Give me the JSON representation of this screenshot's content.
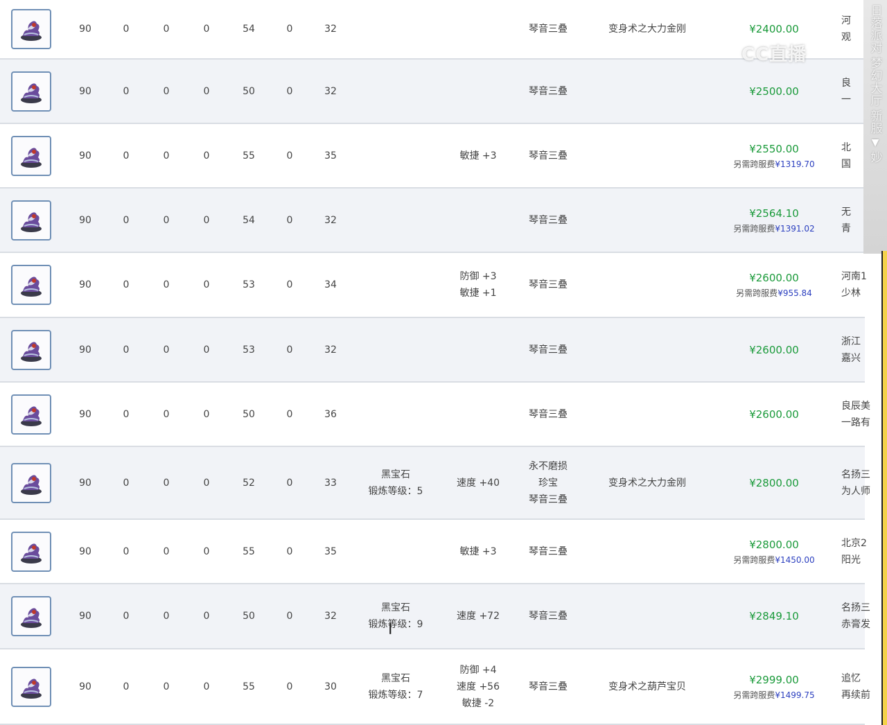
{
  "colors": {
    "price": "#1a9a3a",
    "fee": "#2b3fbf",
    "row_alt": "#f1f3f7",
    "accent_bar": "#f4d24a"
  },
  "listings": [
    {
      "level": "90",
      "c1": "0",
      "c2": "0",
      "c3": "0",
      "c4": "54",
      "c5": "0",
      "c6": "32",
      "gem": [],
      "attrs": [],
      "special": [
        "琴音三叠"
      ],
      "transform": "变身术之大力金刚",
      "price": "¥2400.00",
      "fee": null,
      "seller": [
        "河",
        "观"
      ]
    },
    {
      "level": "90",
      "c1": "0",
      "c2": "0",
      "c3": "0",
      "c4": "50",
      "c5": "0",
      "c6": "32",
      "gem": [],
      "attrs": [],
      "special": [
        "琴音三叠"
      ],
      "transform": "",
      "price": "¥2500.00",
      "fee": null,
      "seller": [
        "良",
        "一"
      ]
    },
    {
      "level": "90",
      "c1": "0",
      "c2": "0",
      "c3": "0",
      "c4": "55",
      "c5": "0",
      "c6": "35",
      "gem": [],
      "attrs": [
        "敏捷 +3"
      ],
      "special": [
        "琴音三叠"
      ],
      "transform": "",
      "price": "¥2550.00",
      "fee": "¥1319.70",
      "seller": [
        "北",
        "国"
      ]
    },
    {
      "level": "90",
      "c1": "0",
      "c2": "0",
      "c3": "0",
      "c4": "54",
      "c5": "0",
      "c6": "32",
      "gem": [],
      "attrs": [],
      "special": [
        "琴音三叠"
      ],
      "transform": "",
      "price": "¥2564.10",
      "fee": "¥1391.02",
      "seller": [
        "无",
        "青"
      ]
    },
    {
      "level": "90",
      "c1": "0",
      "c2": "0",
      "c3": "0",
      "c4": "53",
      "c5": "0",
      "c6": "34",
      "gem": [],
      "attrs": [
        "防御 +3",
        "敏捷 +1"
      ],
      "special": [
        "琴音三叠"
      ],
      "transform": "",
      "price": "¥2600.00",
      "fee": "¥955.84",
      "seller": [
        "河南1",
        "少林"
      ]
    },
    {
      "level": "90",
      "c1": "0",
      "c2": "0",
      "c3": "0",
      "c4": "53",
      "c5": "0",
      "c6": "32",
      "gem": [],
      "attrs": [],
      "special": [
        "琴音三叠"
      ],
      "transform": "",
      "price": "¥2600.00",
      "fee": null,
      "seller": [
        "浙江",
        "嘉兴"
      ]
    },
    {
      "level": "90",
      "c1": "0",
      "c2": "0",
      "c3": "0",
      "c4": "50",
      "c5": "0",
      "c6": "36",
      "gem": [],
      "attrs": [],
      "special": [
        "琴音三叠"
      ],
      "transform": "",
      "price": "¥2600.00",
      "fee": null,
      "seller": [
        "良辰美",
        "一路有"
      ]
    },
    {
      "level": "90",
      "c1": "0",
      "c2": "0",
      "c3": "0",
      "c4": "52",
      "c5": "0",
      "c6": "33",
      "gem": [
        "黑宝石",
        "锻炼等级：5"
      ],
      "attrs": [
        "速度 +40"
      ],
      "special": [
        "永不磨损",
        "珍宝",
        "琴音三叠"
      ],
      "transform": "变身术之大力金刚",
      "price": "¥2800.00",
      "fee": null,
      "seller": [
        "名扬三",
        "为人师"
      ]
    },
    {
      "level": "90",
      "c1": "0",
      "c2": "0",
      "c3": "0",
      "c4": "55",
      "c5": "0",
      "c6": "35",
      "gem": [],
      "attrs": [
        "敏捷 +3"
      ],
      "special": [
        "琴音三叠"
      ],
      "transform": "",
      "price": "¥2800.00",
      "fee": "¥1450.00",
      "seller": [
        "北京2",
        "阳光"
      ]
    },
    {
      "level": "90",
      "c1": "0",
      "c2": "0",
      "c3": "0",
      "c4": "50",
      "c5": "0",
      "c6": "32",
      "gem": [
        "黑宝石",
        "锻炼等级：9"
      ],
      "attrs": [
        "速度 +72"
      ],
      "special": [
        "琴音三叠"
      ],
      "transform": "",
      "price": "¥2849.10",
      "fee": null,
      "seller": [
        "名扬三",
        "赤膏发"
      ]
    },
    {
      "level": "90",
      "c1": "0",
      "c2": "0",
      "c3": "0",
      "c4": "55",
      "c5": "0",
      "c6": "30",
      "gem": [
        "黑宝石",
        "锻炼等级：7"
      ],
      "attrs": [
        "防御 +4",
        "速度 +56",
        "敏捷 -2"
      ],
      "special": [
        "琴音三叠"
      ],
      "transform": "变身术之葫芦宝贝",
      "price": "¥2999.00",
      "fee": "¥1499.75",
      "seller": [
        "追忆",
        "再续前"
      ]
    }
  ],
  "labels": {
    "fee_prefix": "另需跨服费"
  },
  "sidebar": {
    "items": [
      "日落派对",
      "梦幻大厅",
      "新服",
      "妙"
    ],
    "arrow": "▼"
  },
  "watermark": "CC直播"
}
